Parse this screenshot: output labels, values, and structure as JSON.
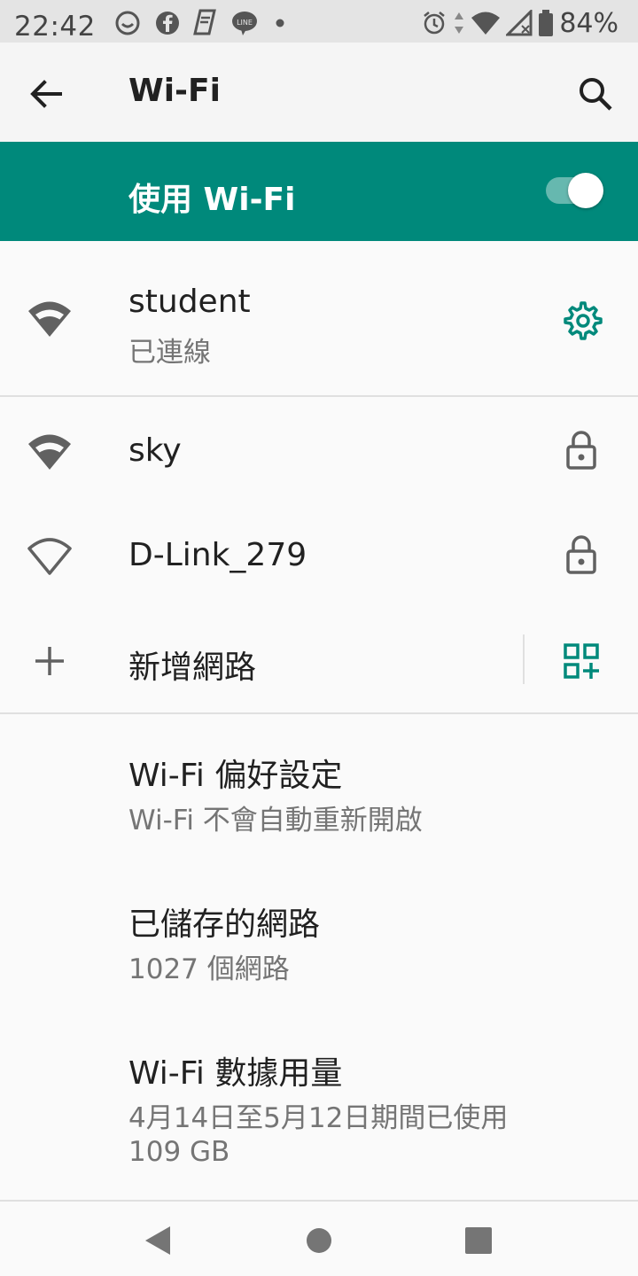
{
  "status_bar": {
    "time": "22:42",
    "battery_text": "84%",
    "left_icons": [
      "messenger-icon",
      "facebook-icon",
      "notes-icon",
      "line-icon",
      "dot-icon"
    ],
    "right_icons": [
      "alarm-icon",
      "data-arrows-icon",
      "wifi-signal-icon",
      "cell-signal-icon",
      "battery-icon"
    ]
  },
  "app_bar": {
    "title": "Wi-Fi",
    "back_icon": "back-arrow-icon",
    "search_icon": "search-icon"
  },
  "master_switch": {
    "label": "使用 Wi-Fi",
    "enabled": true,
    "accent_color": "#00897b"
  },
  "connected_network": {
    "name": "student",
    "status": "已連線",
    "icon": "wifi-icon",
    "action_icon": "gear-icon"
  },
  "networks": [
    {
      "name": "sky",
      "icon": "wifi-icon",
      "lock_icon": "lock-icon"
    },
    {
      "name": "D-Link_279",
      "icon": "wifi-outline-icon",
      "lock_icon": "lock-icon"
    }
  ],
  "add_network": {
    "label": "新增網路",
    "icon": "plus-icon",
    "qr_icon": "qr-code-icon"
  },
  "preferences": [
    {
      "title": "Wi-Fi 偏好設定",
      "subtitle": "Wi-Fi 不會自動重新開啟"
    },
    {
      "title": "已儲存的網路",
      "subtitle": "1027 個網路"
    },
    {
      "title": "Wi-Fi 數據用量",
      "subtitle_line1": "4月14日至5月12日期間已使用",
      "subtitle_line2": "109 GB"
    }
  ],
  "nav_bar": {
    "back_icon": "nav-back-icon",
    "home_icon": "nav-home-icon",
    "recents_icon": "nav-recents-icon"
  }
}
